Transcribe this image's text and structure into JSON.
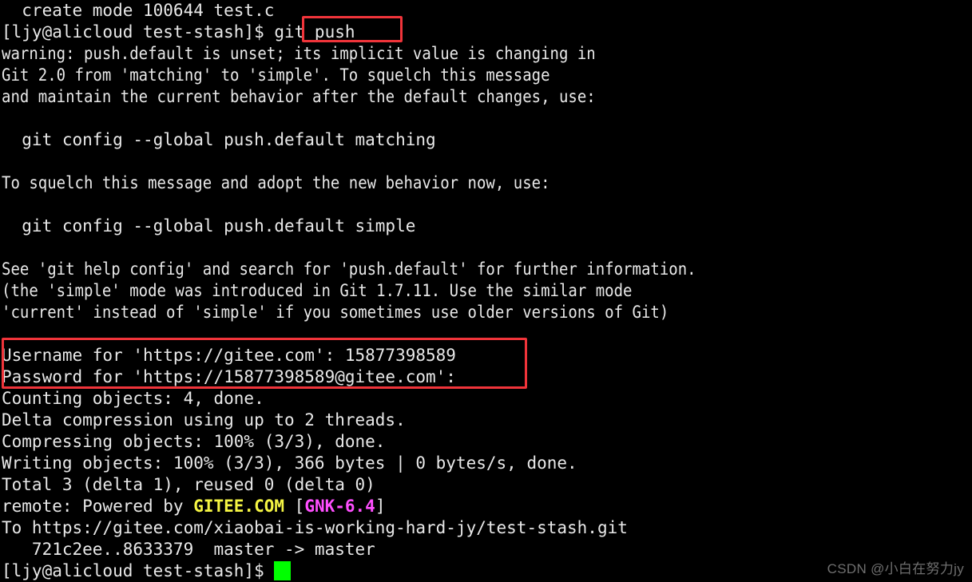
{
  "terminal": {
    "background_color": "#000000",
    "foreground_color": "#e8e8e8",
    "cursor_color": "#00ff00",
    "highlight_color": "#f0343a",
    "lines": [
      {
        "id": "l01",
        "text": "  create mode 100644 test.c"
      },
      {
        "id": "l02",
        "text": "[ljy@alicloud test-stash]$ git push"
      },
      {
        "id": "l03",
        "text": "warning: push.default is unset; its implicit value is changing in"
      },
      {
        "id": "l04",
        "text": "Git 2.0 from 'matching' to 'simple'. To squelch this message"
      },
      {
        "id": "l05",
        "text": "and maintain the current behavior after the default changes, use:"
      },
      {
        "id": "l06",
        "text": ""
      },
      {
        "id": "l07",
        "text": "  git config --global push.default matching"
      },
      {
        "id": "l08",
        "text": ""
      },
      {
        "id": "l09",
        "text": "To squelch this message and adopt the new behavior now, use:"
      },
      {
        "id": "l10",
        "text": ""
      },
      {
        "id": "l11",
        "text": "  git config --global push.default simple"
      },
      {
        "id": "l12",
        "text": ""
      },
      {
        "id": "l13",
        "text": "See 'git help config' and search for 'push.default' for further information."
      },
      {
        "id": "l14",
        "text": "(the 'simple' mode was introduced in Git 1.7.11. Use the similar mode"
      },
      {
        "id": "l15",
        "text": "'current' instead of 'simple' if you sometimes use older versions of Git)"
      },
      {
        "id": "l16",
        "text": ""
      },
      {
        "id": "l17",
        "text": "Username for 'https://gitee.com': 15877398589"
      },
      {
        "id": "l18",
        "text": "Password for 'https://15877398589@gitee.com': "
      },
      {
        "id": "l19",
        "text": "Counting objects: 4, done."
      },
      {
        "id": "l20",
        "text": "Delta compression using up to 2 threads."
      },
      {
        "id": "l21",
        "text": "Compressing objects: 100% (3/3), done."
      },
      {
        "id": "l22",
        "text": "Writing objects: 100% (3/3), 366 bytes | 0 bytes/s, done."
      },
      {
        "id": "l23",
        "text": "Total 3 (delta 1), reused 0 (delta 0)"
      },
      {
        "id": "l24_a",
        "text": "remote: Powered by "
      },
      {
        "id": "l24_b",
        "text": "GITEE.COM"
      },
      {
        "id": "l24_c",
        "text": " ["
      },
      {
        "id": "l24_d",
        "text": "GNK-6.4"
      },
      {
        "id": "l24_e",
        "text": "]"
      },
      {
        "id": "l25",
        "text": "To https://gitee.com/xiaobai-is-working-hard-jy/test-stash.git"
      },
      {
        "id": "l26",
        "text": "   721c2ee..8633379  master -> master"
      },
      {
        "id": "l27",
        "text": "[ljy@alicloud test-stash]$ "
      }
    ]
  },
  "highlights": {
    "git_push_command": "git push",
    "credentials_block": "Username for 'https://gitee.com': 15877398589 / Password for 'https://15877398589@gitee.com':"
  },
  "watermark": {
    "text": "CSDN @小白在努力jy"
  }
}
